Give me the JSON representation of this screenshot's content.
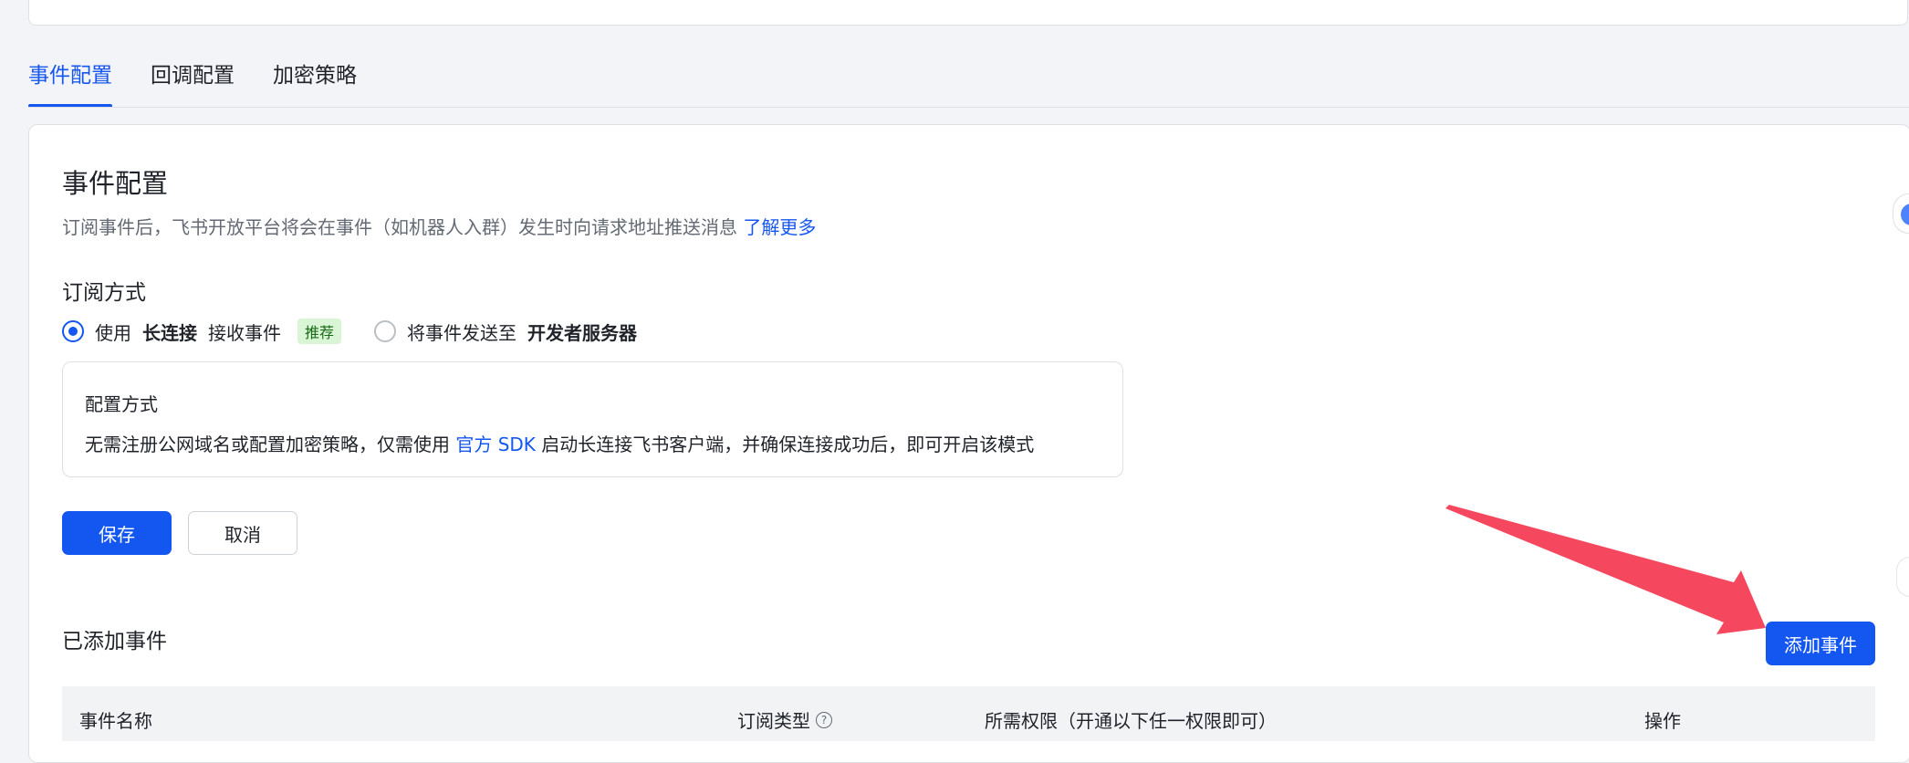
{
  "tabs": [
    {
      "label": "事件配置",
      "active": true
    },
    {
      "label": "回调配置",
      "active": false
    },
    {
      "label": "加密策略",
      "active": false
    }
  ],
  "section": {
    "title": "事件配置",
    "description": "订阅事件后，飞书开放平台将会在事件（如机器人入群）发生时向请求地址推送消息",
    "learn_more": "了解更多"
  },
  "subscription": {
    "label": "订阅方式",
    "option1": {
      "prefix": "使用",
      "bold": "长连接",
      "suffix": "接收事件",
      "tag": "推荐",
      "checked": true
    },
    "option2": {
      "prefix": "将事件发送至",
      "bold": "开发者服务器",
      "checked": false
    }
  },
  "config_box": {
    "title": "配置方式",
    "text_before": "无需注册公网域名或配置加密策略，仅需使用",
    "link": "官方 SDK",
    "text_after": "启动长连接飞书客户端，并确保连接成功后，即可开启该模式"
  },
  "buttons": {
    "save": "保存",
    "cancel": "取消",
    "add_event": "添加事件"
  },
  "added_events": {
    "title": "已添加事件",
    "columns": [
      "事件名称",
      "订阅类型",
      "所需权限（开通以下任一权限即可）",
      "操作"
    ]
  },
  "colors": {
    "accent": "#1456f0",
    "annotation_arrow": "#f5475e",
    "tag_bg": "#d9f5d6"
  },
  "icons": {
    "help": "question-circle-icon"
  }
}
